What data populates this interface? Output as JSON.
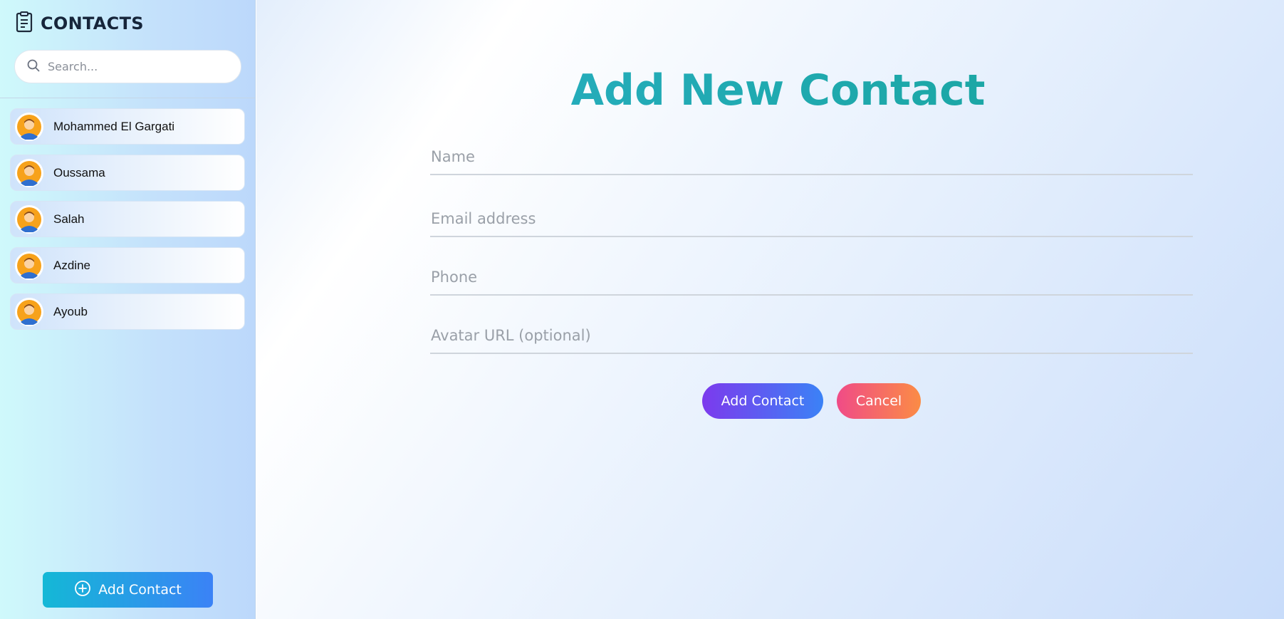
{
  "sidebar": {
    "title": "CONTACTS",
    "title_icon": "clipboard-list-icon",
    "search": {
      "placeholder": "Search...",
      "value": "",
      "icon": "search-icon"
    },
    "contacts": [
      {
        "name": "Mohammed El Gargati",
        "avatar_icon": "user-avatar-icon"
      },
      {
        "name": "Oussama",
        "avatar_icon": "user-avatar-icon"
      },
      {
        "name": "Salah",
        "avatar_icon": "user-avatar-icon"
      },
      {
        "name": "Azdine",
        "avatar_icon": "user-avatar-icon"
      },
      {
        "name": "Ayoub",
        "avatar_icon": "user-avatar-icon"
      }
    ],
    "add_button": {
      "label": "Add Contact",
      "icon": "plus-circle-icon"
    }
  },
  "form": {
    "title": "Add New Contact",
    "fields": {
      "name": {
        "placeholder": "Name",
        "value": ""
      },
      "email": {
        "placeholder": "Email address",
        "value": ""
      },
      "phone": {
        "placeholder": "Phone",
        "value": ""
      },
      "avatar_url": {
        "placeholder": "Avatar URL (optional)",
        "value": ""
      }
    },
    "submit_label": "Add Contact",
    "cancel_label": "Cancel"
  },
  "colors": {
    "title_gradient_start": "#2bb0c9",
    "title_gradient_end": "#15a397",
    "submit_gradient_start": "#7c3aed",
    "submit_gradient_end": "#3b82f6",
    "cancel_gradient_start": "#f04b87",
    "cancel_gradient_end": "#fb8c45",
    "sidebar_button_start": "#14b8d6",
    "sidebar_button_end": "#3b82f6"
  }
}
